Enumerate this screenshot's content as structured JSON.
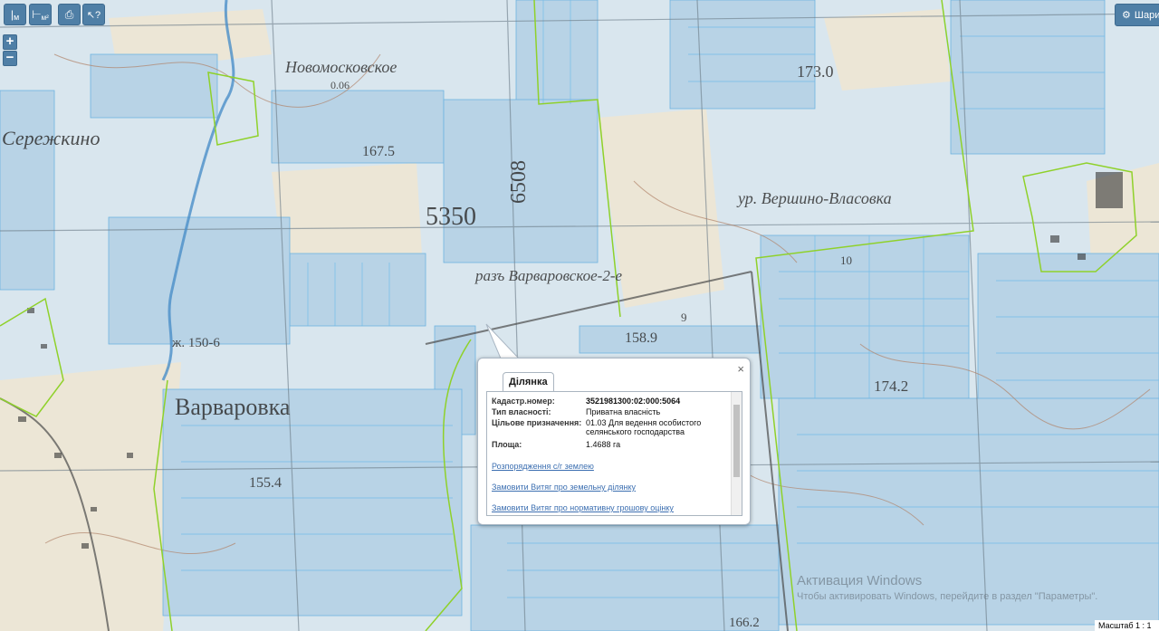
{
  "toolbar": {
    "measure_label": "м",
    "measure_area_label": "м²",
    "layers_label": "Шари"
  },
  "map_labels": [
    "Новомосковское",
    "0.06",
    "Сережкино",
    "167.5",
    "5350",
    "6508",
    "173.0",
    "ур. Вершино-Власовка",
    "разъ Варваровское-2-е",
    "158.9",
    "Варваровка",
    "ж. 150-6",
    "155.4",
    "174.2",
    "10",
    "9",
    "166.2"
  ],
  "popup": {
    "tab_label": "Ділянка",
    "close_label": "×",
    "fields": [
      {
        "label": "Кадастр.номер:",
        "value": "3521981300:02:000:5064",
        "bold": true
      },
      {
        "label": "Тип власності:",
        "value": "Приватна власність",
        "bold": false
      },
      {
        "label": "Цільове призначення:",
        "value": "01.03 Для ведення особистого селянського господарства",
        "bold": false
      },
      {
        "label": "Площа:",
        "value": "1.4688 га",
        "bold": false
      }
    ],
    "links": [
      "Розпорядження с/г землею",
      "Замовити Витяг про земельну ділянку",
      "Замовити Витяг про нормативну грошову оцінку"
    ]
  },
  "scale_text": "Масштаб 1 : 1",
  "watermark": {
    "line1": "Активация Windows",
    "line2": "Чтобы активировать Windows, перейдите в раздел \"Параметры\"."
  }
}
